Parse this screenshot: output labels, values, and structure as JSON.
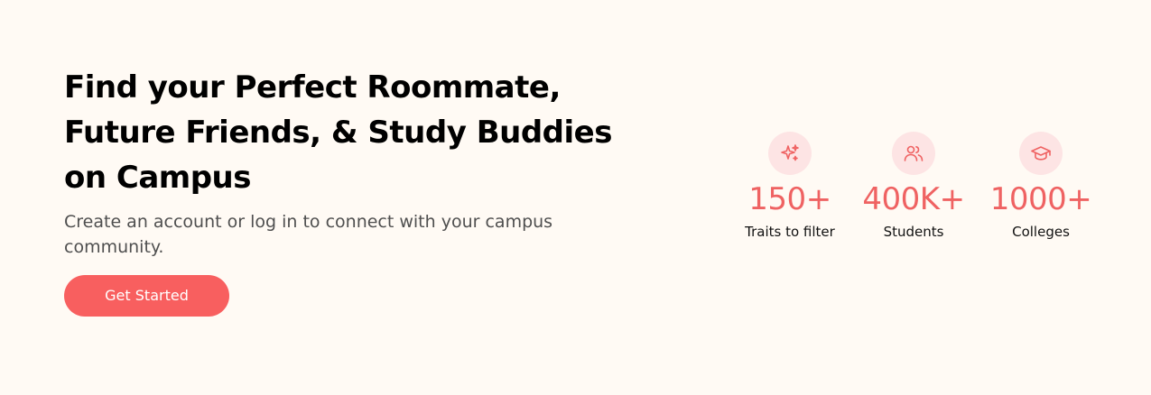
{
  "hero": {
    "title": "Find your Perfect Roommate,\nFuture Friends, & Study Buddies\non Campus",
    "subtitle": "Create an account or log in to connect with your campus community.",
    "cta_label": "Get Started"
  },
  "stats": [
    {
      "icon": "sparkles-icon",
      "value": "150+",
      "label": "Traits to filter"
    },
    {
      "icon": "users-icon",
      "value": "400K+",
      "label": "Students"
    },
    {
      "icon": "graduation-cap-icon",
      "value": "1000+",
      "label": "Colleges"
    }
  ],
  "colors": {
    "background": "#fffaf4",
    "accent": "#f85f5f",
    "stat_value": "#ef6262",
    "icon_bg": "#fde4e4"
  }
}
